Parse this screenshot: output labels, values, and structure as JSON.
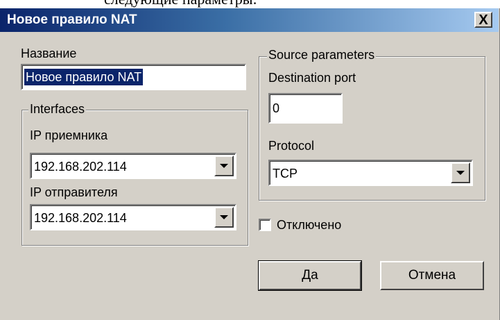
{
  "page_fragment": "следующие параметры:",
  "dialog": {
    "title": "Новое правило NAT",
    "close_label": "X"
  },
  "name_field": {
    "label": "Название",
    "value": "Новое правило NAT"
  },
  "interfaces": {
    "legend": "Interfaces",
    "receiver_label": "IP приемника",
    "receiver_value": "192.168.202.114",
    "sender_label": "IP отправителя",
    "sender_value": "192.168.202.114"
  },
  "source_params": {
    "legend": "Source parameters",
    "dest_port_label": "Destination port",
    "dest_port_value": "0",
    "protocol_label": "Protocol",
    "protocol_value": "TCP"
  },
  "disabled": {
    "label": "Отключено",
    "checked": false
  },
  "buttons": {
    "ok": "Да",
    "cancel": "Отмена"
  }
}
